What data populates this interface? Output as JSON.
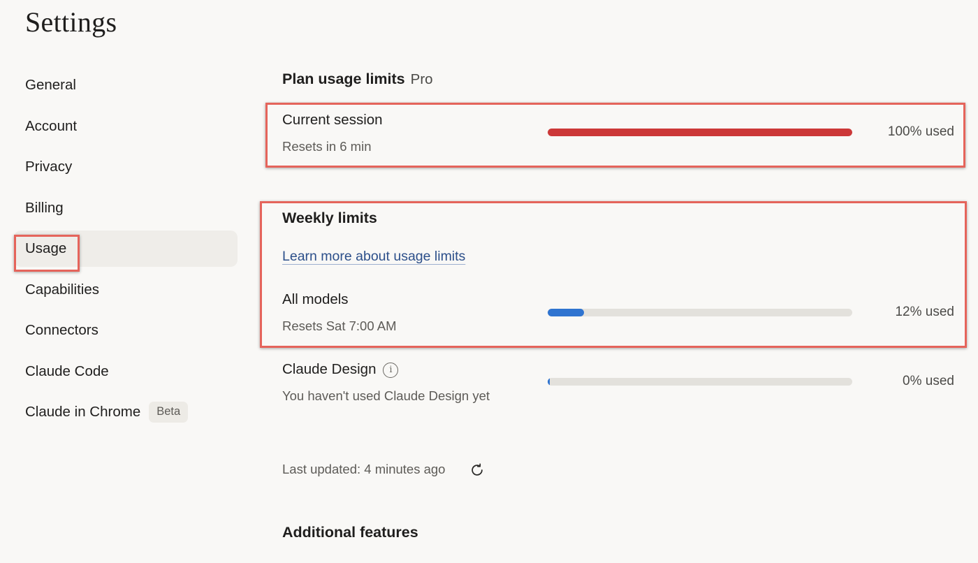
{
  "page": {
    "title": "Settings"
  },
  "sidebar": {
    "items": [
      {
        "label": "General"
      },
      {
        "label": "Account"
      },
      {
        "label": "Privacy"
      },
      {
        "label": "Billing"
      },
      {
        "label": "Usage",
        "active": true
      },
      {
        "label": "Capabilities"
      },
      {
        "label": "Connectors"
      },
      {
        "label": "Claude Code"
      },
      {
        "label": "Claude in Chrome",
        "badge": "Beta"
      }
    ]
  },
  "plan": {
    "heading": "Plan usage limits",
    "tier": "Pro",
    "current_session": {
      "label": "Current session",
      "reset": "Resets in 6 min",
      "percent": 100,
      "percent_text": "100% used",
      "color": "#cc3838"
    }
  },
  "weekly": {
    "heading": "Weekly limits",
    "learn_more": "Learn more about usage limits",
    "all_models": {
      "label": "All models",
      "reset": "Resets Sat 7:00 AM",
      "percent": 12,
      "percent_text": "12% used",
      "color": "#2f74d0"
    },
    "claude_design": {
      "label": "Claude Design",
      "reset": "You haven't used Claude Design yet",
      "percent": 0,
      "percent_text": "0% used",
      "color": "#2f74d0",
      "info_icon": "info-icon"
    }
  },
  "footer": {
    "last_updated": "Last updated: 4 minutes ago",
    "refresh_icon": "refresh-icon"
  },
  "additional": {
    "heading": "Additional features"
  }
}
